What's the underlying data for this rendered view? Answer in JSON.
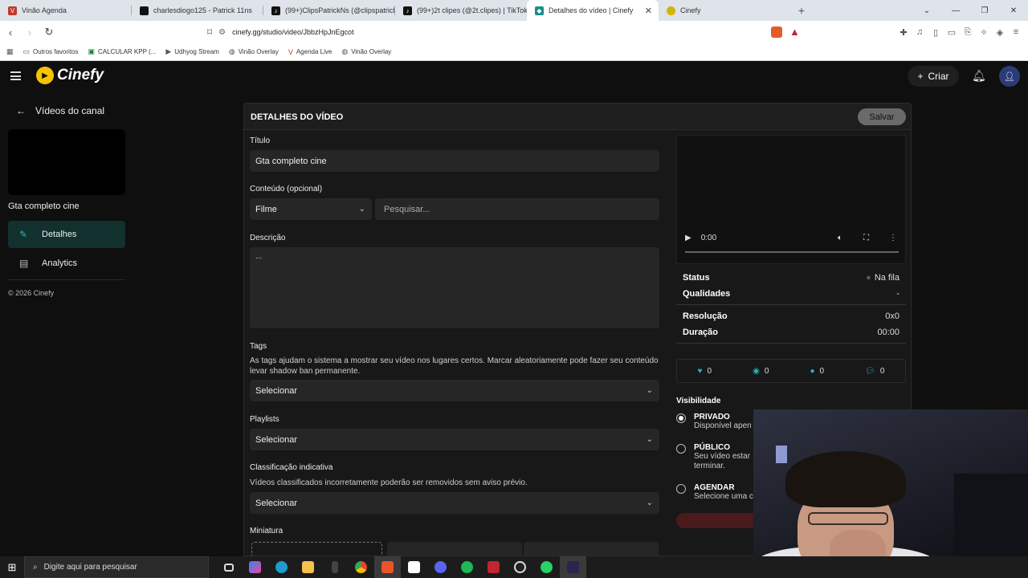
{
  "browser": {
    "tabs": [
      {
        "title": "Vinão Agenda",
        "icon_color": "#c0392b",
        "active": false
      },
      {
        "title": "charlesdiogo125 - Patrick 11ns",
        "icon_color": "#111111",
        "active": false
      },
      {
        "title": "(99+)ClipsPatrickNs (@clipspatrickns",
        "icon_color": "#111111",
        "active": false
      },
      {
        "title": "(99+)2t clipes (@2t.clipes) | TikTok",
        "icon_color": "#111111",
        "active": false
      },
      {
        "title": "Detalhes do vídeo | Cinefy",
        "icon_color": "#1a8c8c",
        "active": true
      },
      {
        "title": "Cinefy",
        "icon_color": "#d4b400",
        "active": false
      }
    ],
    "url": "cinefy.gg/studio/video/JbbzHpJnEgcot",
    "bookmarks": [
      {
        "label": "Outros favoritos",
        "icon": "folder-icon"
      },
      {
        "label": "CALCULAR KPP (...",
        "icon": "sheet-icon"
      },
      {
        "label": "Udhyog Stream",
        "icon": "play-icon"
      },
      {
        "label": "Vinão Overlay",
        "icon": "globe-icon"
      },
      {
        "label": "Agenda Live",
        "icon": "v-icon"
      },
      {
        "label": "Vinão Overlay",
        "icon": "globe-icon"
      }
    ]
  },
  "app": {
    "brand": "Cinefy",
    "create_label": "Criar",
    "back_label": "Vídeos do canal",
    "video_title": "Gta completo cine",
    "nav": [
      {
        "label": "Detalhes",
        "active": true
      },
      {
        "label": "Analytics",
        "active": false
      }
    ],
    "copyright": "© 2026 Cinefy"
  },
  "details": {
    "header": "DETALHES DO VÍDEO",
    "save_label": "Salvar",
    "title_label": "Título",
    "title_value": "Gta completo cine",
    "content_label": "Conteúdo (opcional)",
    "content_type": "Filme",
    "search_placeholder": "Pesquisar...",
    "description_label": "Descrição",
    "description_value": "...",
    "tags_label": "Tags",
    "tags_hint": "As tags ajudam o sistema a mostrar seu vídeo nos lugares certos. Marcar aleatoriamente pode fazer seu conteúdo levar shadow ban permanente.",
    "select_placeholder": "Selecionar",
    "playlists_label": "Playlists",
    "rating_label": "Classificação indicativa",
    "rating_hint": "Vídeos classificados incorretamente poderão ser removidos sem aviso prévio.",
    "thumbnail_label": "Miniatura"
  },
  "video_info": {
    "player_time": "0:00",
    "status_label": "Status",
    "status_value": "Na fila",
    "qualities_label": "Qualidades",
    "qualities_value": "-",
    "resolution_label": "Resolução",
    "resolution_value": "0x0",
    "duration_label": "Duração",
    "duration_value": "00:00",
    "stats": [
      {
        "icon": "heart-icon",
        "value": "0",
        "color": "#2bb3c0"
      },
      {
        "icon": "eye-icon",
        "value": "0",
        "color": "#2bb3c0"
      },
      {
        "icon": "dot-icon",
        "value": "0",
        "color": "#2bb3c0"
      },
      {
        "icon": "comment-icon",
        "value": "0",
        "color": "#2bb3c0"
      }
    ],
    "visibility_label": "Visibilidade",
    "visibility_options": [
      {
        "title": "PRIVADO",
        "desc": "Disponível apen",
        "selected": true
      },
      {
        "title": "PÚBLICO",
        "desc": "Seu vídeo estar terminar.",
        "selected": false
      },
      {
        "title": "AGENDAR",
        "desc": "Selecione uma c",
        "selected": false
      }
    ]
  },
  "taskbar": {
    "search_placeholder": "Digite aqui para pesquisar"
  }
}
